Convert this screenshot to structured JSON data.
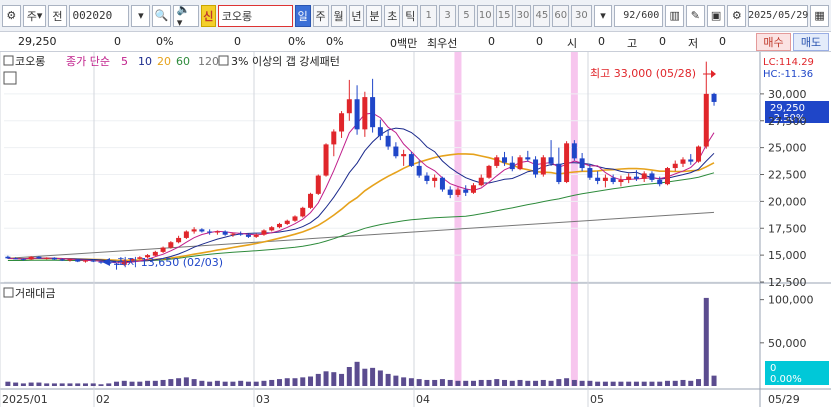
{
  "toolbar": {
    "ju": "주",
    "jeon": "전",
    "code": "002020",
    "shin": "신",
    "stock_name": "코오롱",
    "periods": [
      "일",
      "주",
      "월",
      "년",
      "분",
      "초",
      "틱"
    ],
    "numbers": [
      "1",
      "3",
      "5",
      "10",
      "15",
      "30",
      "45",
      "60"
    ],
    "minute_value": "30",
    "count": "92/600",
    "date": "2025/05/29"
  },
  "infobar": {
    "price": "29,250",
    "v1": "0",
    "v2": "0%",
    "v3": "0",
    "v4": "0%",
    "v5": "0%",
    "volume": "0백만",
    "best_label": "최우선",
    "best1": "0",
    "best2": "0",
    "open_label": "시",
    "open_val": "0",
    "high_label": "고",
    "high_val": "0",
    "low_label": "저",
    "low_val": "0",
    "buy": "매수",
    "sell": "매도"
  },
  "legend": {
    "name": "코오롱",
    "ma_label": "종가 단순",
    "ma5": "5",
    "ma10": "10",
    "ma20": "20",
    "ma60": "60",
    "ma120": "120",
    "pattern": "3% 이상의 갭 강세패턴",
    "lc": "LC:114.29",
    "hc": "HC:-11.36",
    "high_annot": "최고 33,000 (05/28)",
    "low_annot": "최저 13,650 (02/03)",
    "current_price": "29,250",
    "current_pct": "-2.50%",
    "volume_title": "거래대금",
    "volume_current": "0",
    "volume_pct": "0.00%"
  },
  "axis": {
    "price_ticks": [
      "30,000",
      "27,500",
      "25,000",
      "22,500",
      "20,000",
      "17,500",
      "15,000",
      "12,500"
    ],
    "volume_ticks": [
      "100,000",
      "50,000"
    ],
    "x_labels": [
      "2025/01",
      "02",
      "03",
      "04",
      "05",
      "05/29"
    ]
  },
  "colors": {
    "up": "#e0262b",
    "down": "#1f46c8",
    "ma5": "#c0208c",
    "ma10": "#1b2a8c",
    "ma20": "#e6a21c",
    "ma60": "#2e8b3c",
    "ma120": "#777777",
    "highlight": "#f7c6ee",
    "current_box": "#1f46c8",
    "volume_box": "#00c8d8"
  },
  "chart_data": {
    "type": "candlestick",
    "ylim": [
      12500,
      32500
    ],
    "gap_days": [
      58,
      73
    ],
    "candles": [
      [
        14850,
        14950,
        14650,
        14700
      ],
      [
        14700,
        14800,
        14600,
        14650
      ],
      [
        14650,
        14700,
        14500,
        14600
      ],
      [
        14600,
        14900,
        14550,
        14850
      ],
      [
        14850,
        14900,
        14650,
        14700
      ],
      [
        14700,
        14800,
        14600,
        14750
      ],
      [
        14750,
        14800,
        14550,
        14600
      ],
      [
        14600,
        14700,
        14450,
        14500
      ],
      [
        14500,
        14650,
        14400,
        14600
      ],
      [
        14600,
        14650,
        14350,
        14400
      ],
      [
        14400,
        14550,
        14300,
        14500
      ],
      [
        14500,
        14600,
        14350,
        14400
      ],
      [
        14400,
        14450,
        14200,
        14300
      ],
      [
        14300,
        14400,
        14100,
        14200
      ],
      [
        14200,
        14300,
        13650,
        14100
      ],
      [
        14100,
        14600,
        14000,
        14500
      ],
      [
        14500,
        14700,
        14400,
        14650
      ],
      [
        14650,
        14900,
        14600,
        14800
      ],
      [
        14800,
        15100,
        14700,
        15000
      ],
      [
        14950,
        15400,
        14900,
        15300
      ],
      [
        15300,
        15800,
        15200,
        15700
      ],
      [
        15700,
        16300,
        15600,
        16200
      ],
      [
        16200,
        16800,
        16100,
        16600
      ],
      [
        16600,
        17300,
        16500,
        17200
      ],
      [
        17200,
        17600,
        17000,
        17400
      ],
      [
        17400,
        17500,
        17100,
        17200
      ],
      [
        17200,
        17400,
        16900,
        17100
      ],
      [
        17100,
        17300,
        16900,
        17200
      ],
      [
        17200,
        17300,
        16800,
        16900
      ],
      [
        16900,
        17100,
        16700,
        17000
      ],
      [
        17000,
        17200,
        16800,
        16900
      ],
      [
        16900,
        17000,
        16600,
        16700
      ],
      [
        16700,
        17000,
        16600,
        16900
      ],
      [
        16900,
        17400,
        16800,
        17300
      ],
      [
        17300,
        17700,
        17200,
        17600
      ],
      [
        17600,
        18000,
        17500,
        17900
      ],
      [
        17900,
        18300,
        17800,
        18200
      ],
      [
        18200,
        18700,
        18100,
        18600
      ],
      [
        18600,
        19500,
        18500,
        19400
      ],
      [
        19400,
        20800,
        19300,
        20700
      ],
      [
        20700,
        22500,
        20600,
        22400
      ],
      [
        22400,
        25400,
        22300,
        25300
      ],
      [
        25300,
        26700,
        24200,
        26500
      ],
      [
        26500,
        28400,
        25900,
        28200
      ],
      [
        28200,
        31300,
        27500,
        29500
      ],
      [
        29500,
        30800,
        26200,
        26700
      ],
      [
        26700,
        30200,
        26000,
        29700
      ],
      [
        29700,
        31400,
        26400,
        26900
      ],
      [
        26900,
        27600,
        25700,
        26100
      ],
      [
        26100,
        26700,
        24800,
        25100
      ],
      [
        25100,
        25500,
        24000,
        24200
      ],
      [
        24200,
        24800,
        23300,
        24400
      ],
      [
        24400,
        24600,
        23200,
        23300
      ],
      [
        23300,
        23800,
        22200,
        22400
      ],
      [
        22400,
        22700,
        21600,
        21900
      ],
      [
        21900,
        22500,
        21300,
        22200
      ],
      [
        22200,
        22300,
        20900,
        21100
      ],
      [
        21100,
        21400,
        20300,
        20600
      ],
      [
        20600,
        21300,
        20400,
        21100
      ],
      [
        21100,
        21500,
        20500,
        20800
      ],
      [
        20800,
        21700,
        20700,
        21500
      ],
      [
        21500,
        22500,
        21400,
        22200
      ],
      [
        22200,
        23400,
        22100,
        23300
      ],
      [
        23300,
        24300,
        23100,
        24100
      ],
      [
        24100,
        24600,
        23300,
        23600
      ],
      [
        23600,
        24200,
        22800,
        23000
      ],
      [
        23000,
        24300,
        22900,
        24100
      ],
      [
        24100,
        24700,
        23700,
        23900
      ],
      [
        23900,
        24200,
        22200,
        22500
      ],
      [
        22500,
        24300,
        22300,
        24100
      ],
      [
        24100,
        25700,
        23300,
        23500
      ],
      [
        23500,
        25000,
        21600,
        21800
      ],
      [
        21800,
        25600,
        21700,
        25400
      ],
      [
        25400,
        25700,
        23800,
        24000
      ],
      [
        24000,
        24500,
        22800,
        23100
      ],
      [
        23100,
        23500,
        22000,
        22200
      ],
      [
        22200,
        22800,
        21600,
        21900
      ],
      [
        21900,
        22500,
        21300,
        22200
      ],
      [
        22200,
        22500,
        21600,
        21800
      ],
      [
        21800,
        22400,
        21400,
        22000
      ],
      [
        22000,
        22600,
        21700,
        22300
      ],
      [
        22300,
        22900,
        21900,
        22100
      ],
      [
        22100,
        22800,
        21800,
        22600
      ],
      [
        22600,
        22800,
        21800,
        22000
      ],
      [
        22000,
        22300,
        21400,
        21600
      ],
      [
        21600,
        23200,
        21500,
        23100
      ],
      [
        23100,
        23800,
        22800,
        23500
      ],
      [
        23500,
        24100,
        23200,
        23900
      ],
      [
        23900,
        24400,
        23400,
        23700
      ],
      [
        23700,
        25200,
        23600,
        25100
      ],
      [
        25100,
        33000,
        24900,
        30000
      ],
      [
        30000,
        30100,
        28900,
        29250
      ]
    ],
    "volume": [
      5,
      4,
      3,
      4,
      4,
      3,
      3,
      3,
      3,
      3,
      3,
      3,
      2,
      3,
      5,
      6,
      5,
      5,
      6,
      6,
      7,
      8,
      9,
      10,
      8,
      6,
      5,
      6,
      5,
      5,
      6,
      5,
      5,
      6,
      7,
      8,
      9,
      9,
      10,
      11,
      14,
      17,
      16,
      14,
      22,
      28,
      20,
      21,
      18,
      14,
      12,
      10,
      9,
      8,
      7,
      7,
      8,
      7,
      6,
      6,
      6,
      7,
      7,
      8,
      7,
      6,
      7,
      6,
      6,
      7,
      6,
      8,
      9,
      7,
      6,
      6,
      5,
      5,
      5,
      5,
      5,
      5,
      5,
      5,
      5,
      6,
      6,
      7,
      6,
      8,
      102,
      12
    ]
  }
}
